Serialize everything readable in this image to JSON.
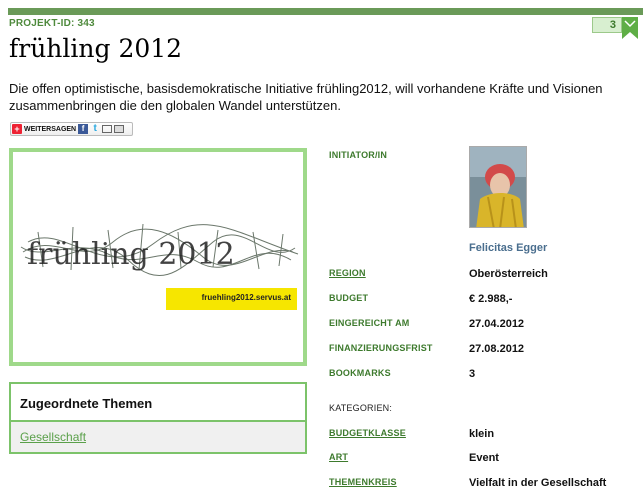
{
  "project_id_label": "PROJEKT-ID: 343",
  "bookmark_count_badge": "3",
  "title": "frühling 2012",
  "description": "Die offen optimistische, basisdemokratische Initiative frühling2012, will vorhandene Kräfte und Visionen zusammenbringen die den globalen Wandel unterstützen.",
  "share": {
    "label": "WEITERSAGEN",
    "facebook": "f",
    "twitter": "t"
  },
  "logo": {
    "script_text": "frühling 2012",
    "url_text": "fruehling2012.servus.at"
  },
  "themes": {
    "heading": "Zugeordnete Themen",
    "items": [
      "Gesellschaft"
    ]
  },
  "initiator": {
    "label": "INITIATOR/IN",
    "name": "Felicitas Egger"
  },
  "details": [
    {
      "label": "REGION",
      "value": "Oberösterreich"
    },
    {
      "label": "BUDGET",
      "value": "€ 2.988,-"
    },
    {
      "label": "EINGEREICHT AM",
      "value": "27.04.2012"
    },
    {
      "label": "FINANZIERUNGSFRIST",
      "value": "27.08.2012"
    },
    {
      "label": "BOOKMARKS",
      "value": "3"
    }
  ],
  "categories_label": "KATEGORIEN:",
  "categories": [
    {
      "label": "BUDGETKLASSE",
      "value": "klein"
    },
    {
      "label": "ART",
      "value": "Event"
    },
    {
      "label": "THEMENKREIS",
      "value": "Vielfalt in der Gesellschaft"
    }
  ],
  "colors": {
    "accent_green": "#6a9a58",
    "label_green": "#3d7a2d",
    "yellow": "#f6e600"
  }
}
